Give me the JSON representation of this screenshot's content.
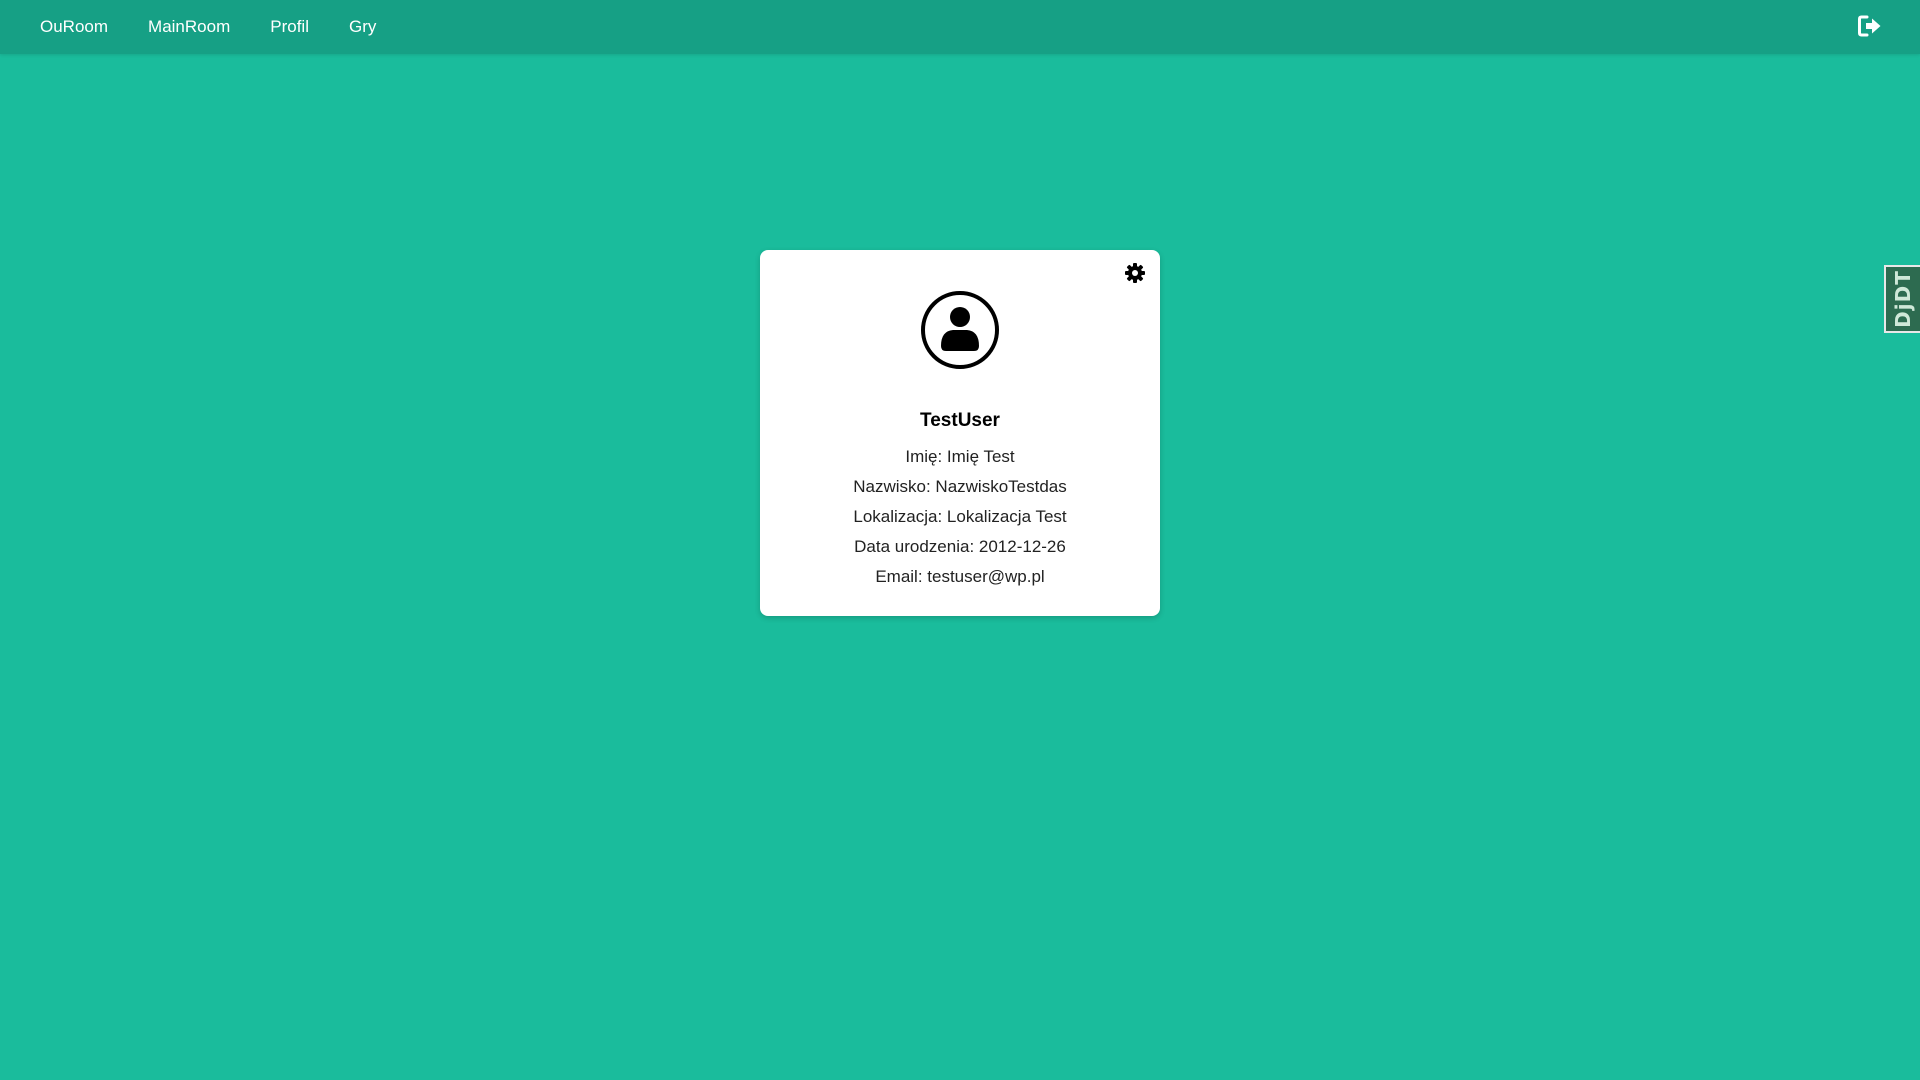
{
  "nav": {
    "links": [
      "OuRoom",
      "MainRoom",
      "Profil",
      "Gry"
    ],
    "logout_icon": "sign-out-icon"
  },
  "profile": {
    "settings_icon": "gear-icon",
    "avatar_icon": "user-circle-icon",
    "username": "TestUser",
    "first_name": "Imię: Imię Test",
    "last_name": "Nazwisko: NazwiskoTestdas",
    "location": "Lokalizacja: Lokalizacja Test",
    "birth_date": "Data urodzenia: 2012-12-26",
    "email": "Email: testuser@wp.pl"
  },
  "debug_toolbar": {
    "label": "DjDT"
  },
  "colors": {
    "background": "#1abc9c",
    "navbar": "#16a085",
    "card": "#ffffff"
  }
}
